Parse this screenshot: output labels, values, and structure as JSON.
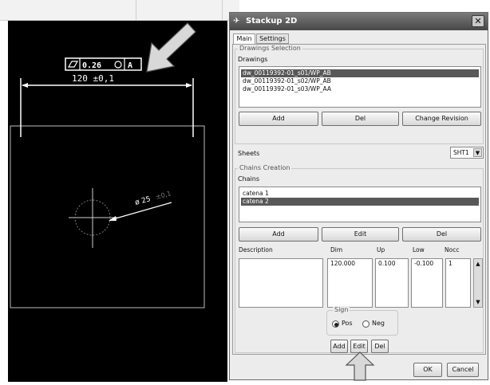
{
  "dialog": {
    "title": "Stackup 2D",
    "tabs": [
      "Main",
      "Settings"
    ],
    "drawings_selection_legend": "Drawings Selection",
    "drawings_label": "Drawings",
    "drawings": [
      {
        "name": "dw_00119392-01_s01/WP_AB",
        "selected": true
      },
      {
        "name": "dw_00119392-01_s02/WP_AB",
        "selected": false
      },
      {
        "name": "dw_00119392-01_s03/WP_AA",
        "selected": false
      }
    ],
    "drawing_buttons": {
      "add": "Add",
      "del": "Del",
      "change_revision": "Change Revision"
    },
    "sheets_label": "Sheets",
    "sheets_value": "SHT1",
    "chains_creation_legend": "Chains Creation",
    "chains_label": "Chains",
    "chains": [
      {
        "name": "catena 1",
        "selected": false
      },
      {
        "name": "catena 2",
        "selected": true
      }
    ],
    "chain_buttons": {
      "add": "Add",
      "edit": "Edit",
      "del": "Del"
    },
    "columns": {
      "description": "Description",
      "dim": "Dim",
      "up": "Up",
      "low": "Low",
      "nocc": "Nocc"
    },
    "row": {
      "description": "",
      "dim": "120.000",
      "up": "0.100",
      "low": "-0.100",
      "nocc": "1"
    },
    "sign_legend": "Sign",
    "sign_pos": "Pos",
    "sign_neg": "Neg",
    "sign_selected": "Pos",
    "row_buttons": {
      "add": "Add",
      "edit": "Edit",
      "del": "Del"
    },
    "ok": "OK",
    "cancel": "Cancel"
  },
  "cad": {
    "gdt_tolerance": "0.26",
    "gdt_datum": "A",
    "horizontal_dim": "120 ±0,1",
    "diameter_dim": "ø 25",
    "diameter_tol": "±0,1"
  },
  "colors": {
    "canvas": "#000000",
    "cad_lines": "#ffffff",
    "title_bar": "#4f4f4f",
    "selection": "#585858",
    "dialog_bg": "#ececec",
    "arrow_fill": "#d8d8d8"
  },
  "icons": [
    "callout-arrow",
    "close-icon",
    "stackup-app-icon",
    "dropdown-arrow-icon",
    "scroll-up-icon",
    "scroll-down-icon"
  ]
}
